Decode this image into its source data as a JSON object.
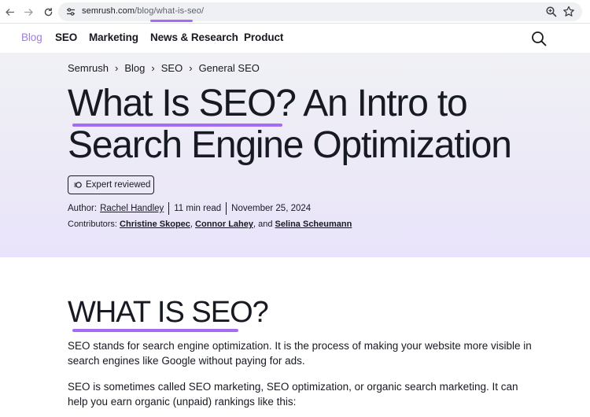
{
  "browser": {
    "url_domain": "semrush.com",
    "url_path": "/blog/what-is-seo/",
    "icons": [
      "back-arrow-icon",
      "forward-arrow-icon",
      "reload-icon",
      "site-info-icon",
      "zoom-icon",
      "bookmark-star-icon"
    ]
  },
  "nav": {
    "items": [
      {
        "label": "Blog",
        "active": true
      },
      {
        "label": "SEO"
      },
      {
        "label": "Marketing"
      },
      {
        "label": "News & Research"
      },
      {
        "label": "Product"
      }
    ],
    "search_icon": "search-icon"
  },
  "hero": {
    "breadcrumb": [
      "Semrush",
      "Blog",
      "SEO",
      "General SEO"
    ],
    "title_line1": "What Is SEO? An Intro to",
    "title_line2": "Search Engine Optimization",
    "badge": "Expert reviewed",
    "author_label": "Author:",
    "author": "Rachel Handley",
    "read_time": "11 min read",
    "date": "November 25, 2024",
    "contributors_label": "Contributors:",
    "contributor1": "Christine Skopec",
    "contributor2": "Connor Lahey",
    "and_text": ", and",
    "contributor3": "Selina Scheumann"
  },
  "content": {
    "heading": "WHAT IS SEO?",
    "para1": "SEO stands for search engine optimization. It is the process of making your website more visible in search engines like Google without paying for ads.",
    "para2": "SEO is sometimes called SEO marketing, SEO optimization, or organic search marketing. It can help you earn organic (unpaid) rankings like this:"
  },
  "colors": {
    "accent": "#a66bf5",
    "nav_active": "#9f7ae6",
    "text": "#171a22",
    "hero_bg": "#ece9f7"
  }
}
